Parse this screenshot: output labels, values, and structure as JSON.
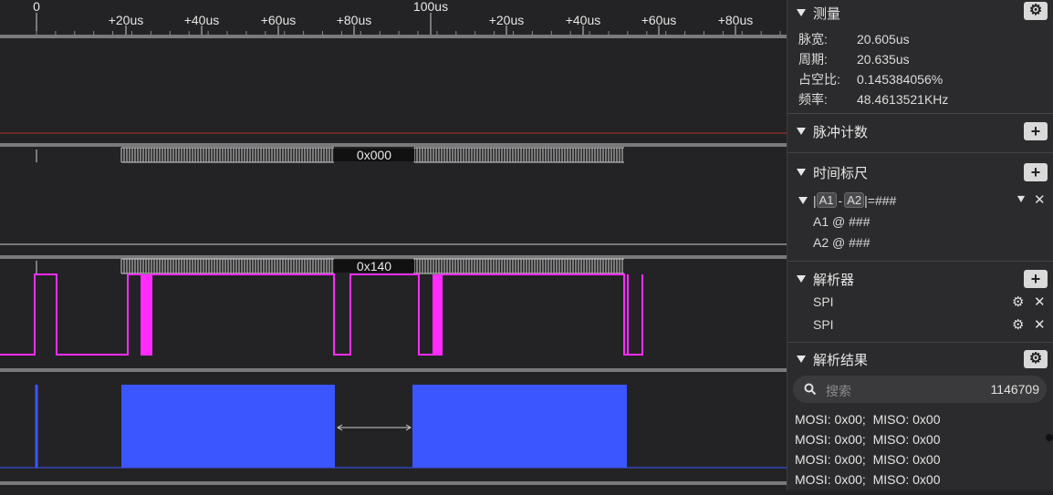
{
  "ruler": {
    "labels": [
      "0",
      "+20us",
      "+40us",
      "+60us",
      "+80us",
      "100us",
      "+20us",
      "+40us",
      "+60us",
      "+80us"
    ]
  },
  "channels": {
    "bus1_value": "0x000",
    "bus2_value": "0x140"
  },
  "colors": {
    "background": "#232325",
    "pink": "#ff2bff",
    "blue": "#3b55ff",
    "red_line": "#b13a2a"
  },
  "measure": {
    "title": "测量",
    "rows": [
      {
        "k": "脉宽:",
        "v": "20.605us"
      },
      {
        "k": "周期:",
        "v": "20.635us"
      },
      {
        "k": "占空比:",
        "v": "0.145384056%"
      },
      {
        "k": "频率:",
        "v": "48.4613521KHz"
      }
    ]
  },
  "pulse_count": {
    "title": "脉冲计数"
  },
  "time_ruler": {
    "title": "时间标尺",
    "a1": "A1",
    "a2": "A2",
    "eq": "=###",
    "a1_row": "A1 @ ###",
    "a2_row": "A2 @ ###"
  },
  "analyzer": {
    "title": "解析器",
    "items": [
      "SPI",
      "SPI"
    ]
  },
  "results": {
    "title": "解析结果",
    "search_placeholder": "搜索",
    "count": "1146709",
    "rows": [
      "MOSI: 0x00;  MISO: 0x00",
      "MOSI: 0x00;  MISO: 0x00",
      "MOSI: 0x00;  MISO: 0x00",
      "MOSI: 0x00;  MISO: 0x00"
    ]
  },
  "icons": {
    "gear": "gear-icon",
    "plus": "plus-icon",
    "close": "close-icon",
    "pin": "pin-icon",
    "search": "search-icon"
  }
}
